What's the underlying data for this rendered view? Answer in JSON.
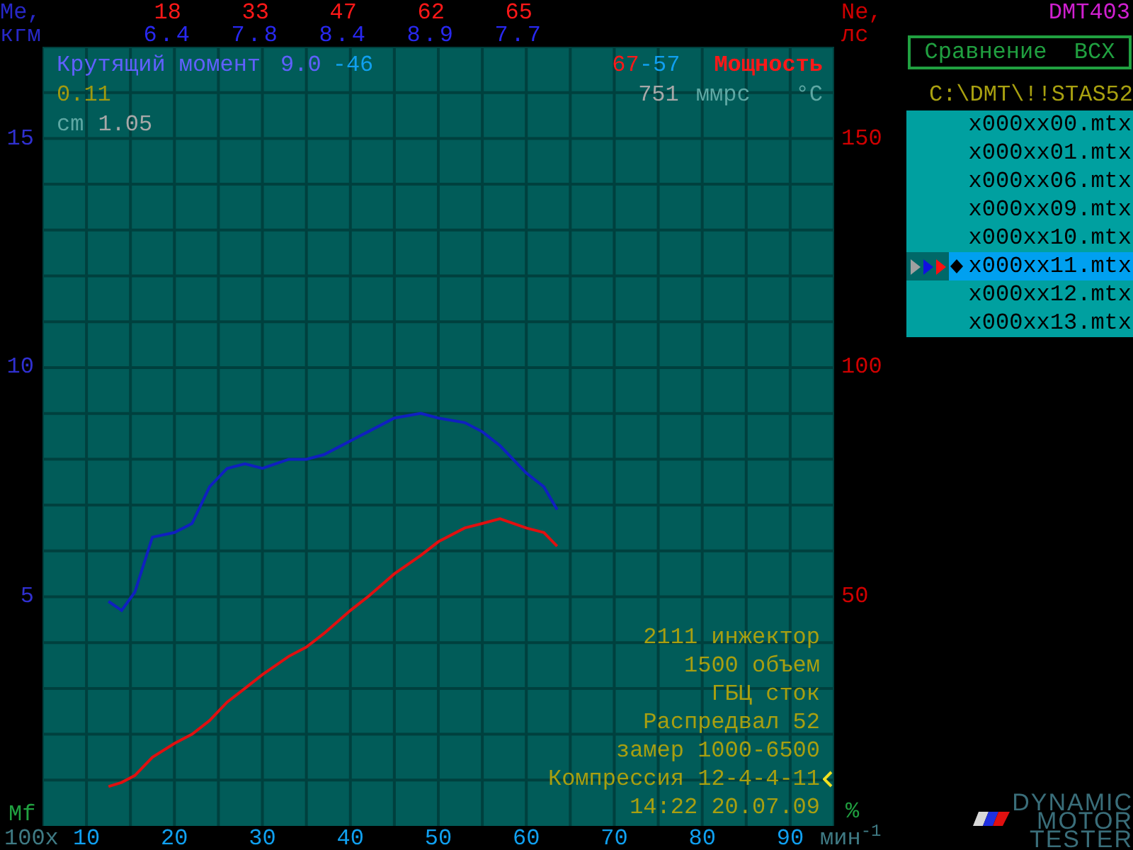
{
  "header": {
    "torque_label": "Me,",
    "torque_unit": "кгм",
    "power_label": "Ne,",
    "power_unit": "лс",
    "device": "DMT403"
  },
  "readouts": [
    {
      "power": "18",
      "torque": "6.4"
    },
    {
      "power": "33",
      "torque": "7.8"
    },
    {
      "power": "47",
      "torque": "8.4"
    },
    {
      "power": "62",
      "torque": "8.9"
    },
    {
      "power": "65",
      "torque": "7.7"
    }
  ],
  "plot": {
    "torque": {
      "max": "9.0",
      "max_rpm": "-46",
      "chart_data": {
        "type": "line",
        "x": [
          12.5,
          14,
          15.5,
          17.5,
          20,
          22,
          24,
          26,
          28,
          30,
          33,
          35,
          37,
          40,
          42,
          45,
          48,
          50,
          53,
          55,
          57,
          60,
          62,
          63.5
        ],
        "xlim": [
          5,
          95
        ],
        "ylim": [
          0,
          17
        ],
        "xticks": [
          {
            "value": 10,
            "label": "10"
          },
          {
            "value": 20,
            "label": "20"
          },
          {
            "value": 30,
            "label": "30"
          },
          {
            "value": 40,
            "label": "40"
          },
          {
            "value": 50,
            "label": "50"
          },
          {
            "value": 60,
            "label": "60"
          },
          {
            "value": 70,
            "label": "70"
          },
          {
            "value": 80,
            "label": "80"
          },
          {
            "value": 90,
            "label": "90"
          }
        ],
        "yticks": [
          {
            "value": 5,
            "label": "5"
          },
          {
            "value": 10,
            "label": "10"
          },
          {
            "value": 15,
            "label": "15"
          }
        ],
        "series": [
          {
            "name": "Крутящий момент",
            "color": "#1020c0",
            "values": [
              4.9,
              4.7,
              5.1,
              6.3,
              6.4,
              6.6,
              7.4,
              7.8,
              7.9,
              7.8,
              8.0,
              8.0,
              8.1,
              8.4,
              8.6,
              8.9,
              9.0,
              8.9,
              8.8,
              8.6,
              8.3,
              7.7,
              7.4,
              6.9
            ]
          }
        ]
      }
    },
    "power": {
      "max": "67",
      "max_rpm": "-57",
      "chart_data": {
        "type": "line",
        "x": [
          12.5,
          14,
          15.5,
          17.5,
          20,
          22,
          24,
          26,
          28,
          30,
          33,
          35,
          37,
          40,
          42,
          45,
          48,
          50,
          53,
          55,
          57,
          60,
          62,
          63.5
        ],
        "xlim": [
          5,
          95
        ],
        "ylim": [
          0,
          170
        ],
        "yticks": [
          {
            "value": 50,
            "label": "50"
          },
          {
            "value": 100,
            "label": "100"
          },
          {
            "value": 150,
            "label": "150"
          }
        ],
        "series": [
          {
            "name": "Мощность",
            "color": "#e01010",
            "values": [
              8.6,
              9.5,
              11,
              15,
              18,
              20,
              23,
              27,
              30,
              33,
              37,
              39,
              42,
              47,
              50,
              55,
              59,
              62,
              65,
              66,
              67,
              65,
              64,
              61
            ]
          }
        ]
      }
    },
    "value_1": "0.11",
    "cm_label": "cm",
    "cm_value": "1.05",
    "temp_value": "751",
    "temp_label": "ммрс",
    "temp_unit": "°C",
    "mf_label": "Mf",
    "percent_label": "%",
    "x_factor": "100x",
    "x_unit": "мин$^{-1}$",
    "notes": [
      {
        "text": "2111 инжектор",
        "cursor": false
      },
      {
        "text": "1500 объем",
        "cursor": false
      },
      {
        "text": "ГБЦ сток",
        "cursor": false
      },
      {
        "text": "Распредвал 52",
        "cursor": false
      },
      {
        "text": "замер 1000-6500",
        "cursor": false
      },
      {
        "text": "Компрессия 12-4-4-11",
        "cursor": true
      },
      {
        "text": "14:22 20.07.09",
        "cursor": false
      }
    ]
  },
  "compare_button": "Сравнение  ВСХ",
  "path": "C:\\DMT\\!!STAS52",
  "files": [
    {
      "name": "x000xx00.mtx",
      "selected": false
    },
    {
      "name": "x000xx01.mtx",
      "selected": false
    },
    {
      "name": "x000xx06.mtx",
      "selected": false
    },
    {
      "name": "x000xx09.mtx",
      "selected": false
    },
    {
      "name": "x000xx10.mtx",
      "selected": false
    },
    {
      "name": "x000xx11.mtx",
      "selected": true
    },
    {
      "name": "x000xx12.mtx",
      "selected": false
    },
    {
      "name": "x000xx13.mtx",
      "selected": false
    }
  ],
  "logo": [
    "DYNAMIC",
    "MOTOR",
    "TESTER"
  ]
}
